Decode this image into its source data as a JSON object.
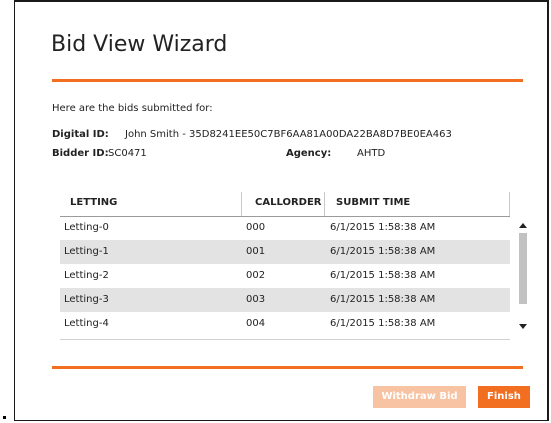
{
  "wizard": {
    "title": "Bid View Wizard",
    "intro": "Here are the bids submitted for:",
    "digital_id_label": "Digital ID:",
    "digital_id_value": "John Smith - 35D8241EE50C7BF6AA81A00DA22BA8D7BE0EA463",
    "bidder_id_label": "Bidder ID:",
    "bidder_id_value": "SC0471",
    "agency_label": "Agency:",
    "agency_value": "AHTD"
  },
  "table": {
    "columns": [
      "LETTING",
      "CALLORDER",
      "SUBMIT TIME"
    ],
    "rows": [
      {
        "letting": "Letting-0",
        "callorder": "000",
        "submit_time": "6/1/2015 1:58:38 AM"
      },
      {
        "letting": "Letting-1",
        "callorder": "001",
        "submit_time": "6/1/2015 1:58:38 AM"
      },
      {
        "letting": "Letting-2",
        "callorder": "002",
        "submit_time": "6/1/2015 1:58:38 AM"
      },
      {
        "letting": "Letting-3",
        "callorder": "003",
        "submit_time": "6/1/2015 1:58:38 AM"
      },
      {
        "letting": "Letting-4",
        "callorder": "004",
        "submit_time": "6/1/2015 1:58:38 AM"
      }
    ]
  },
  "buttons": {
    "withdraw_label": "Withdraw Bid",
    "finish_label": "Finish"
  },
  "colors": {
    "accent": "#f26f21",
    "accent_disabled": "#f7c3a3",
    "row_alt": "#e3e3e3"
  },
  "icons": {
    "scroll_up": "triangle-up",
    "scroll_down": "triangle-down"
  }
}
